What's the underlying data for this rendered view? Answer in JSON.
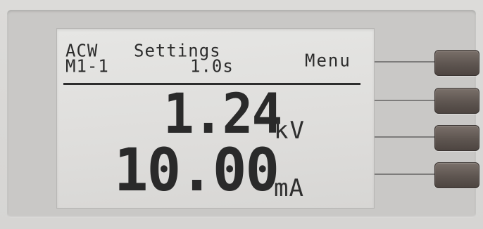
{
  "display": {
    "mode": "ACW",
    "title": "Settings",
    "step": "M1-1",
    "time": "1.0s",
    "menu_label": "Menu",
    "voltage_value": "1.24",
    "voltage_unit": "kV",
    "current_value": "10.00",
    "current_unit": "mA"
  },
  "colors": {
    "lcd_background": "#e0e0de",
    "lcd_text": "#2c2c2c",
    "softkey": "#5e5550",
    "panel": "#d9d8d6"
  }
}
